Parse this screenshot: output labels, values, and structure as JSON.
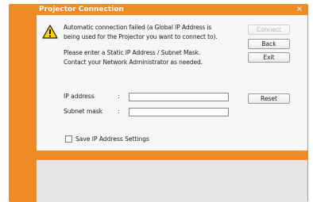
{
  "window": {
    "title": "Projector Connection",
    "close_glyph": "×"
  },
  "message": {
    "line1": "Automatic connection failed (a Global IP Address is",
    "line2": "being used for the Projector you want to connect to).",
    "line3": "Please enter a Static IP Address / Subnet Mask.",
    "line4": "Contact your Network Administrator as needed."
  },
  "form": {
    "ip_label": "IP address",
    "mask_label": "Subnet mask",
    "colon": ":",
    "ip_value": "",
    "mask_value": "",
    "save_checkbox_label": "Save IP Address Settings",
    "save_checked": false
  },
  "buttons": {
    "connect": "Connect",
    "back": "Back",
    "exit": "Exit",
    "reset": "Reset"
  },
  "icons": {
    "warning": "warning-icon",
    "close": "close-icon"
  },
  "colors": {
    "frame": "#f08a24",
    "panel": "#f6f6f6",
    "panel_lower": "#e6e6e6",
    "warning_fill": "#ffd200"
  }
}
